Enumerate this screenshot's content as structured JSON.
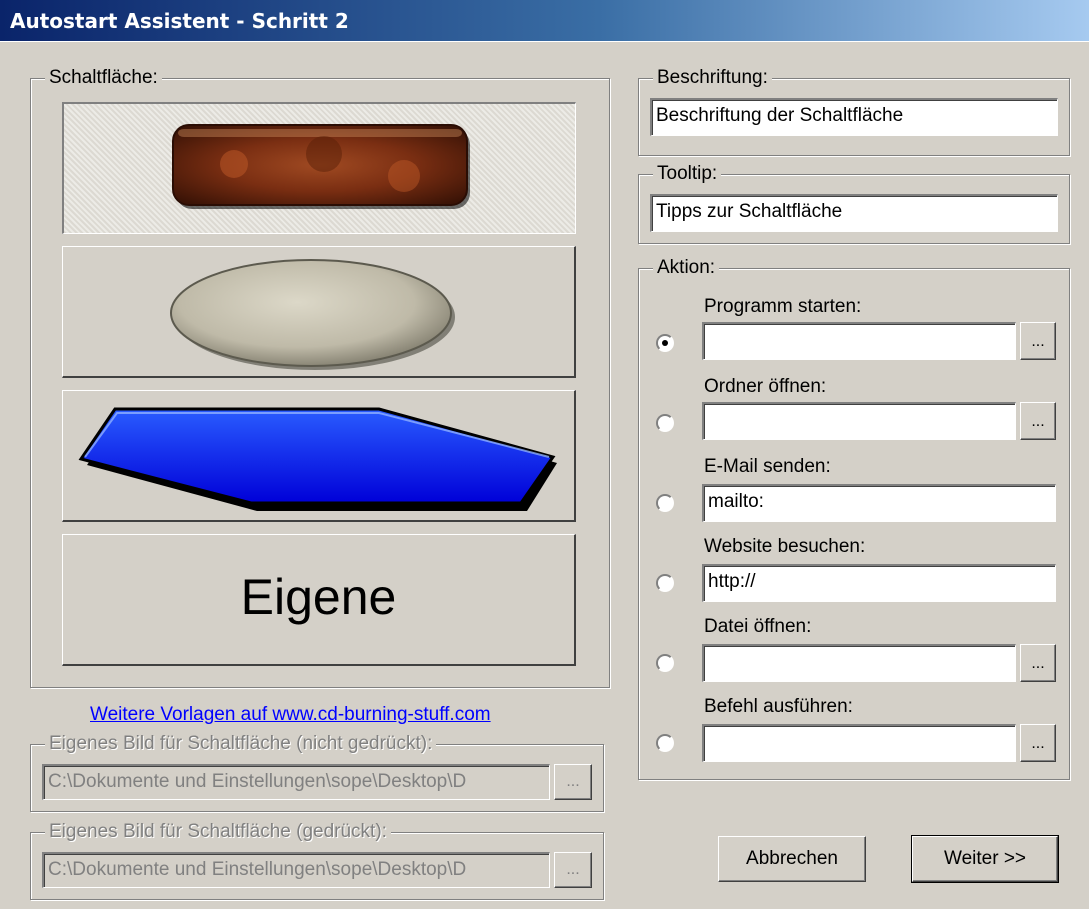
{
  "window": {
    "title": "Autostart Assistent - Schritt 2"
  },
  "button_group": {
    "legend": "Schaltfläche:",
    "templates": [
      "rust-rounded-rect",
      "stone-ellipse",
      "blue-hexagon"
    ],
    "selected_template": "rust-rounded-rect",
    "custom_label": "Eigene"
  },
  "templates_link": "Weitere Vorlagen auf www.cd-burning-stuff.com",
  "image_normal": {
    "legend": "Eigenes Bild für Schaltfläche (nicht gedrückt):",
    "value": "C:\\Dokumente und Einstellungen\\sope\\Desktop\\D",
    "browse": "..."
  },
  "image_pressed": {
    "legend": "Eigenes Bild für Schaltfläche (gedrückt):",
    "value": "C:\\Dokumente und Einstellungen\\sope\\Desktop\\D",
    "browse": "..."
  },
  "caption": {
    "legend": "Beschriftung:",
    "value": "Beschriftung der Schaltfläche"
  },
  "tooltip": {
    "legend": "Tooltip:",
    "value": "Tipps zur Schaltfläche"
  },
  "action": {
    "legend": "Aktion:",
    "selected": "program",
    "options": [
      {
        "id": "program",
        "label": "Programm starten:",
        "value": "",
        "browse": "..."
      },
      {
        "id": "folder",
        "label": "Ordner öffnen:",
        "value": "",
        "browse": "..."
      },
      {
        "id": "email",
        "label": "E-Mail senden:",
        "value": "mailto:"
      },
      {
        "id": "website",
        "label": "Website besuchen:",
        "value": "http://"
      },
      {
        "id": "file",
        "label": "Datei öffnen:",
        "value": "",
        "browse": "..."
      },
      {
        "id": "command",
        "label": "Befehl ausführen:",
        "value": "",
        "browse": "..."
      }
    ]
  },
  "footer": {
    "cancel": "Abbrechen",
    "next": "Weiter >>"
  }
}
